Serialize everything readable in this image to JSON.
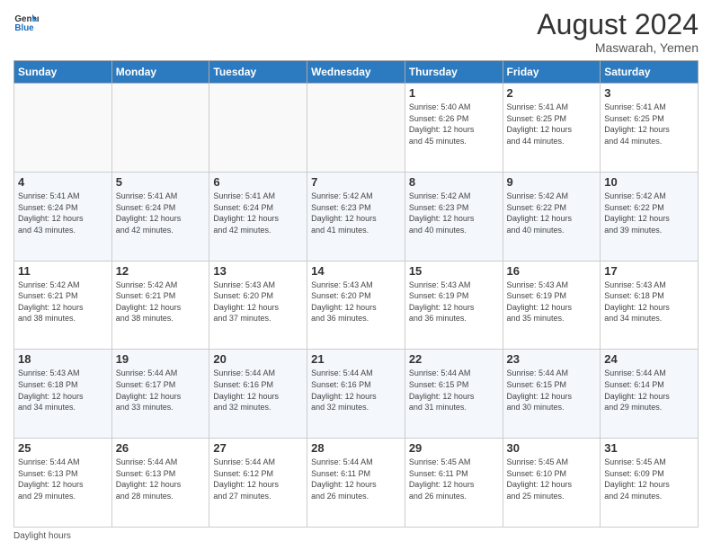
{
  "header": {
    "logo_line1": "General",
    "logo_line2": "Blue",
    "main_title": "August 2024",
    "subtitle": "Maswarah, Yemen"
  },
  "days_of_week": [
    "Sunday",
    "Monday",
    "Tuesday",
    "Wednesday",
    "Thursday",
    "Friday",
    "Saturday"
  ],
  "weeks": [
    [
      {
        "day": "",
        "info": ""
      },
      {
        "day": "",
        "info": ""
      },
      {
        "day": "",
        "info": ""
      },
      {
        "day": "",
        "info": ""
      },
      {
        "day": "1",
        "info": "Sunrise: 5:40 AM\nSunset: 6:26 PM\nDaylight: 12 hours\nand 45 minutes."
      },
      {
        "day": "2",
        "info": "Sunrise: 5:41 AM\nSunset: 6:25 PM\nDaylight: 12 hours\nand 44 minutes."
      },
      {
        "day": "3",
        "info": "Sunrise: 5:41 AM\nSunset: 6:25 PM\nDaylight: 12 hours\nand 44 minutes."
      }
    ],
    [
      {
        "day": "4",
        "info": "Sunrise: 5:41 AM\nSunset: 6:24 PM\nDaylight: 12 hours\nand 43 minutes."
      },
      {
        "day": "5",
        "info": "Sunrise: 5:41 AM\nSunset: 6:24 PM\nDaylight: 12 hours\nand 42 minutes."
      },
      {
        "day": "6",
        "info": "Sunrise: 5:41 AM\nSunset: 6:24 PM\nDaylight: 12 hours\nand 42 minutes."
      },
      {
        "day": "7",
        "info": "Sunrise: 5:42 AM\nSunset: 6:23 PM\nDaylight: 12 hours\nand 41 minutes."
      },
      {
        "day": "8",
        "info": "Sunrise: 5:42 AM\nSunset: 6:23 PM\nDaylight: 12 hours\nand 40 minutes."
      },
      {
        "day": "9",
        "info": "Sunrise: 5:42 AM\nSunset: 6:22 PM\nDaylight: 12 hours\nand 40 minutes."
      },
      {
        "day": "10",
        "info": "Sunrise: 5:42 AM\nSunset: 6:22 PM\nDaylight: 12 hours\nand 39 minutes."
      }
    ],
    [
      {
        "day": "11",
        "info": "Sunrise: 5:42 AM\nSunset: 6:21 PM\nDaylight: 12 hours\nand 38 minutes."
      },
      {
        "day": "12",
        "info": "Sunrise: 5:42 AM\nSunset: 6:21 PM\nDaylight: 12 hours\nand 38 minutes."
      },
      {
        "day": "13",
        "info": "Sunrise: 5:43 AM\nSunset: 6:20 PM\nDaylight: 12 hours\nand 37 minutes."
      },
      {
        "day": "14",
        "info": "Sunrise: 5:43 AM\nSunset: 6:20 PM\nDaylight: 12 hours\nand 36 minutes."
      },
      {
        "day": "15",
        "info": "Sunrise: 5:43 AM\nSunset: 6:19 PM\nDaylight: 12 hours\nand 36 minutes."
      },
      {
        "day": "16",
        "info": "Sunrise: 5:43 AM\nSunset: 6:19 PM\nDaylight: 12 hours\nand 35 minutes."
      },
      {
        "day": "17",
        "info": "Sunrise: 5:43 AM\nSunset: 6:18 PM\nDaylight: 12 hours\nand 34 minutes."
      }
    ],
    [
      {
        "day": "18",
        "info": "Sunrise: 5:43 AM\nSunset: 6:18 PM\nDaylight: 12 hours\nand 34 minutes."
      },
      {
        "day": "19",
        "info": "Sunrise: 5:44 AM\nSunset: 6:17 PM\nDaylight: 12 hours\nand 33 minutes."
      },
      {
        "day": "20",
        "info": "Sunrise: 5:44 AM\nSunset: 6:16 PM\nDaylight: 12 hours\nand 32 minutes."
      },
      {
        "day": "21",
        "info": "Sunrise: 5:44 AM\nSunset: 6:16 PM\nDaylight: 12 hours\nand 32 minutes."
      },
      {
        "day": "22",
        "info": "Sunrise: 5:44 AM\nSunset: 6:15 PM\nDaylight: 12 hours\nand 31 minutes."
      },
      {
        "day": "23",
        "info": "Sunrise: 5:44 AM\nSunset: 6:15 PM\nDaylight: 12 hours\nand 30 minutes."
      },
      {
        "day": "24",
        "info": "Sunrise: 5:44 AM\nSunset: 6:14 PM\nDaylight: 12 hours\nand 29 minutes."
      }
    ],
    [
      {
        "day": "25",
        "info": "Sunrise: 5:44 AM\nSunset: 6:13 PM\nDaylight: 12 hours\nand 29 minutes."
      },
      {
        "day": "26",
        "info": "Sunrise: 5:44 AM\nSunset: 6:13 PM\nDaylight: 12 hours\nand 28 minutes."
      },
      {
        "day": "27",
        "info": "Sunrise: 5:44 AM\nSunset: 6:12 PM\nDaylight: 12 hours\nand 27 minutes."
      },
      {
        "day": "28",
        "info": "Sunrise: 5:44 AM\nSunset: 6:11 PM\nDaylight: 12 hours\nand 26 minutes."
      },
      {
        "day": "29",
        "info": "Sunrise: 5:45 AM\nSunset: 6:11 PM\nDaylight: 12 hours\nand 26 minutes."
      },
      {
        "day": "30",
        "info": "Sunrise: 5:45 AM\nSunset: 6:10 PM\nDaylight: 12 hours\nand 25 minutes."
      },
      {
        "day": "31",
        "info": "Sunrise: 5:45 AM\nSunset: 6:09 PM\nDaylight: 12 hours\nand 24 minutes."
      }
    ]
  ],
  "footer": {
    "daylight_label": "Daylight hours"
  }
}
